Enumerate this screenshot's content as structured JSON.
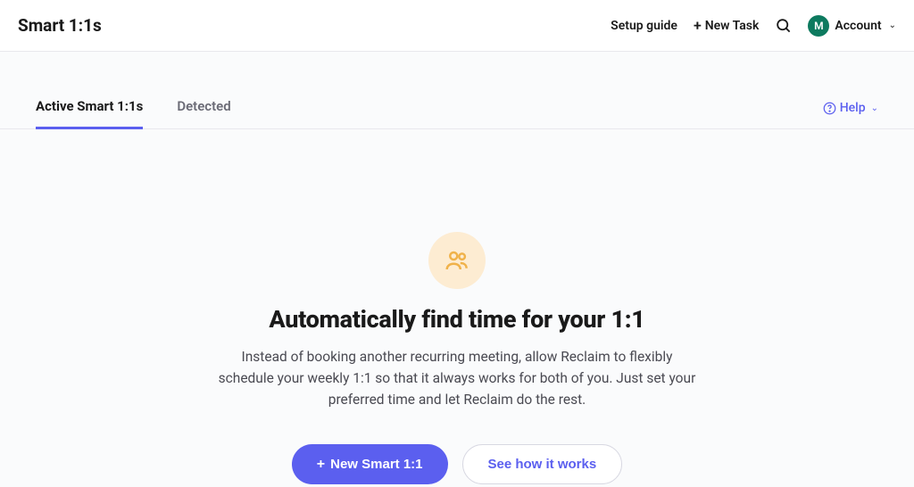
{
  "header": {
    "title": "Smart 1:1s",
    "setup_guide": "Setup guide",
    "new_task": "New Task",
    "account_label": "Account",
    "avatar_initial": "M"
  },
  "tabs": {
    "active": "Active Smart 1:1s",
    "detected": "Detected"
  },
  "help_label": "Help",
  "empty": {
    "title": "Automatically find time for your 1:1",
    "description": "Instead of booking another recurring meeting, allow Reclaim to flexibly schedule your weekly 1:1 so that it always works for both of you. Just set your preferred time and let Reclaim do the rest.",
    "primary_cta": "New Smart 1:1",
    "secondary_cta": "See how it works"
  },
  "colors": {
    "accent": "#5b5fef",
    "avatar_bg": "#0d7a5f",
    "icon_circle_bg": "#fdecd2",
    "icon_color": "#f0b24a"
  }
}
